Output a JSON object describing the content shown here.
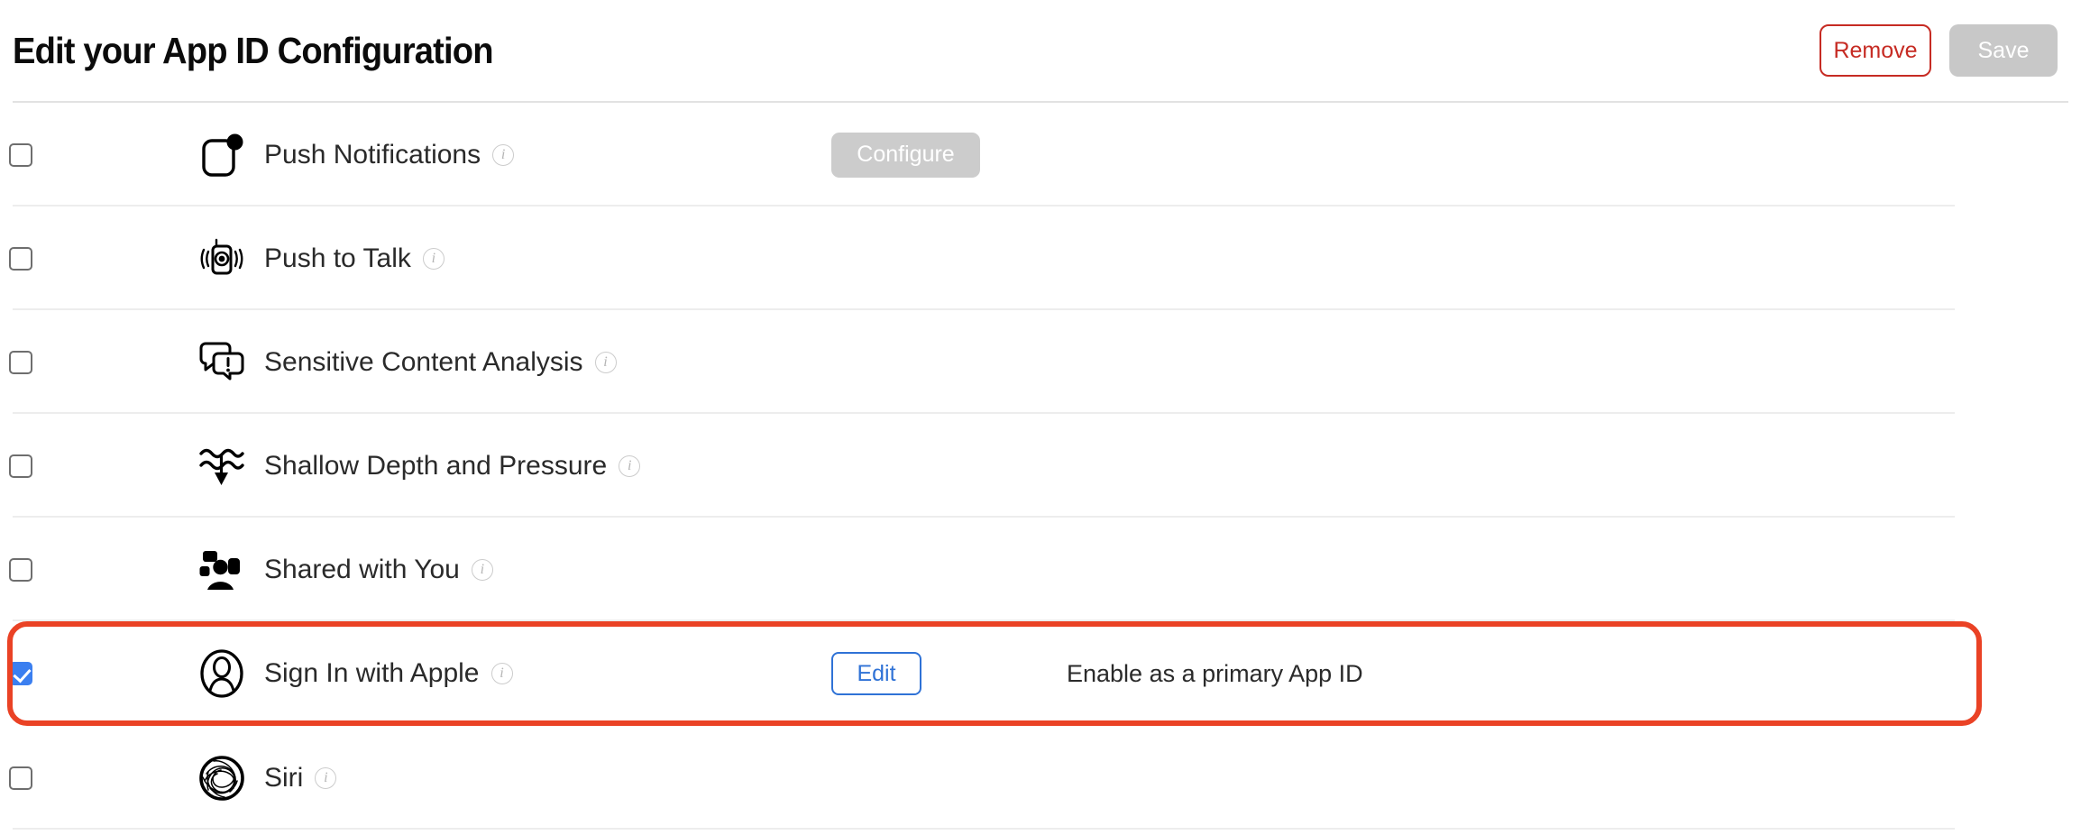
{
  "header": {
    "title": "Edit your App ID Configuration",
    "remove_label": "Remove",
    "save_label": "Save"
  },
  "colors": {
    "highlight_border": "#ea4225",
    "remove_red": "#c62b23",
    "edit_blue": "#2f72d6",
    "checkbox_blue": "#3b7ff0",
    "disabled_gray": "#cccccc",
    "divider": "#ededed",
    "text": "#2a2a2a"
  },
  "capabilities": [
    {
      "id": "push-notifications",
      "label": "Push Notifications",
      "icon": "push-notifications-icon",
      "checked": false,
      "action_label": "Configure",
      "action_kind": "disabled",
      "note": "",
      "highlighted": false
    },
    {
      "id": "push-to-talk",
      "label": "Push to Talk",
      "icon": "push-to-talk-icon",
      "checked": false,
      "action_label": "",
      "action_kind": "none",
      "note": "",
      "highlighted": false
    },
    {
      "id": "sensitive-content-analysis",
      "label": "Sensitive Content Analysis",
      "icon": "sensitive-content-analysis-icon",
      "checked": false,
      "action_label": "",
      "action_kind": "none",
      "note": "",
      "highlighted": false
    },
    {
      "id": "shallow-depth-and-pressure",
      "label": "Shallow Depth and Pressure",
      "icon": "shallow-depth-icon",
      "checked": false,
      "action_label": "",
      "action_kind": "none",
      "note": "",
      "highlighted": false
    },
    {
      "id": "shared-with-you",
      "label": "Shared with You",
      "icon": "shared-with-you-icon",
      "checked": false,
      "action_label": "",
      "action_kind": "none",
      "note": "",
      "highlighted": false
    },
    {
      "id": "sign-in-with-apple",
      "label": "Sign In with Apple",
      "icon": "sign-in-with-apple-icon",
      "checked": true,
      "action_label": "Edit",
      "action_kind": "outline-blue",
      "note": "Enable as a primary App ID",
      "highlighted": true
    },
    {
      "id": "siri",
      "label": "Siri",
      "icon": "siri-icon",
      "checked": false,
      "action_label": "",
      "action_kind": "none",
      "note": "",
      "highlighted": false
    }
  ],
  "info_glyph": "i"
}
